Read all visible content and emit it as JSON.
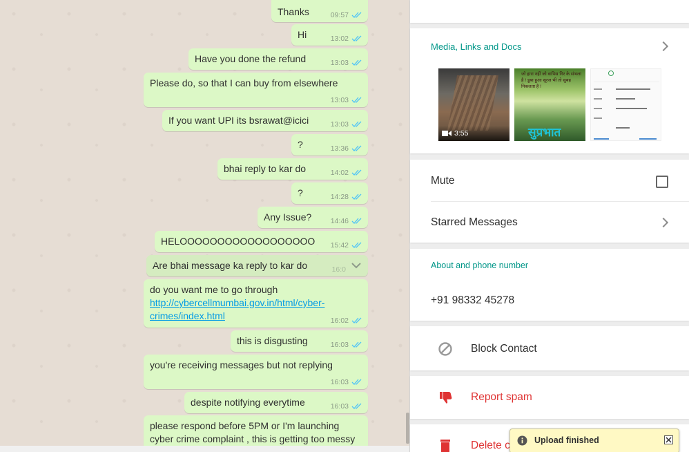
{
  "messages": [
    {
      "text": "Thanks",
      "time": "09:57"
    },
    {
      "text": "Hi",
      "time": "13:02"
    },
    {
      "text": "Have you done the refund",
      "time": "13:03"
    },
    {
      "text": "Please do, so that I can buy from elsewhere",
      "time": "13:03"
    },
    {
      "text": "If you want UPI its bsrawat@icici",
      "time": "13:03"
    },
    {
      "text": "?",
      "time": "13:36"
    },
    {
      "text": "bhai reply to kar do",
      "time": "14:02"
    },
    {
      "text": "?",
      "time": "14:28"
    },
    {
      "text": "Any Issue?",
      "time": "14:46"
    },
    {
      "text": "HELOOOOOOOOOOOOOOOOOO",
      "time": "15:42"
    },
    {
      "text": "Are bhai message ka reply to kar do",
      "time": "16:0"
    },
    {
      "text": "do you want me to go through",
      "link1": "http://cybercellmumbai.gov.in/html/cyber-",
      "link2": "crimes/index.html",
      "time": "16:02"
    },
    {
      "text": "this is disgusting",
      "time": "16:03"
    },
    {
      "text": "you're receiving messages but not replying",
      "time": "16:03"
    },
    {
      "text": "despite notifying everytime",
      "time": "16:03"
    },
    {
      "text": "please respond before 5PM or I'm launching",
      "text2": "cyber crime complaint , this is getting too messy"
    }
  ],
  "panel": {
    "media_label": "Media, Links and Docs",
    "video_duration": "3:55",
    "thumb2_text": "जो हारा नहीं जो वापिस गिर के संभला है ! डूबा हुआ सूरज भी तो सुबह निकलता है !",
    "thumb2_brand": "सुप्रभात",
    "mute_label": "Mute",
    "mute_checked": false,
    "starred_label": "Starred Messages",
    "about_label": "About and phone number",
    "phone": "+91 98332 45278",
    "block_label": "Block Contact",
    "report_label": "Report spam",
    "delete_label": "Delete c"
  },
  "toast": {
    "text": "Upload finished"
  },
  "colors": {
    "bubble": "#dcf8c6",
    "accent": "#009688",
    "danger": "#df3333",
    "ticks": "#4fc3f7"
  }
}
